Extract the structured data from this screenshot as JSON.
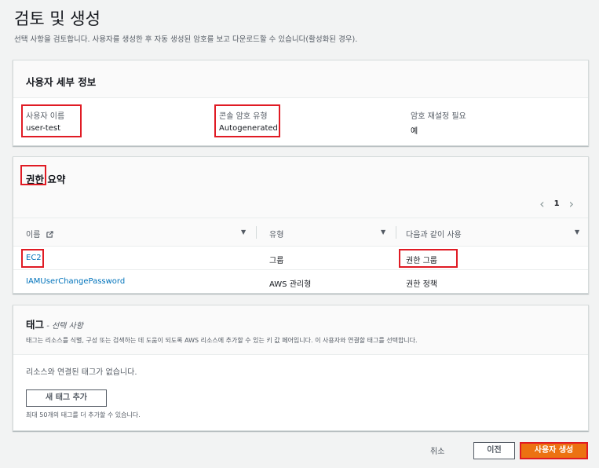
{
  "page": {
    "title": "검토 및 생성",
    "description": "선택 사항을 검토합니다. 사용자를 생성한 후 자동 생성된 암호를 보고 다운로드할 수 있습니다(활성화된 경우)."
  },
  "user_details": {
    "title": "사용자 세부 정보",
    "fields": [
      {
        "label": "사용자 이름",
        "value": "user-test"
      },
      {
        "label": "콘솔 암호 유형",
        "value": "Autogenerated"
      },
      {
        "label": "암호 재설정 필요",
        "value": "예"
      }
    ]
  },
  "permissions": {
    "title_part1": "권한",
    "title_part2": " 요약",
    "pager": {
      "prev": "‹",
      "page": "1",
      "next": "›"
    },
    "columns": [
      "이름",
      "유형",
      "다음과 같이 사용"
    ],
    "rows": [
      {
        "name": "EC2",
        "type": "그룹",
        "used_as": "권한 그룹"
      },
      {
        "name": "IAMUserChangePassword",
        "type": "AWS 관리형",
        "used_as": "권한 정책"
      }
    ]
  },
  "tags": {
    "title": "태그",
    "subtitle": " - 선택 사항",
    "description": "태그는 리소스를 식별, 구성 또는 검색하는 데 도움이 되도록 AWS 리소스에 추가할 수 있는 키 값 페어입니다. 이 사용자와 연결할 태그를 선택합니다.",
    "empty_text": "리소스와 연결된 태그가 없습니다.",
    "add_button": "새 태그 추가",
    "limit_text": "최대 50개의 태그를 더 추가할 수 있습니다."
  },
  "footer": {
    "cancel": "취소",
    "previous": "이전",
    "create": "사용자 생성"
  },
  "colors": {
    "primary": "#ec7211",
    "link": "#0073bb",
    "highlight": "#e01b24"
  }
}
